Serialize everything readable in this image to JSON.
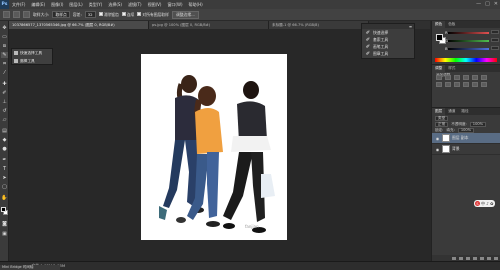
{
  "app": {
    "logo": "Ps"
  },
  "menu": [
    "文件(F)",
    "编辑(E)",
    "图像(I)",
    "图层(L)",
    "类型(Y)",
    "选择(S)",
    "滤镜(T)",
    "视图(V)",
    "窗口(W)",
    "帮助(H)"
  ],
  "window_controls": [
    "—",
    "□",
    "✕"
  ],
  "options_bar": {
    "sample_size_label": "取样大小:",
    "sample_size_value": "取样点",
    "tolerance_label": "容差:",
    "tolerance_value": "32",
    "antialias_label": "消除锯齿",
    "contiguous_label": "连续",
    "all_layers_label": "对所有图层取样",
    "refine_button": "调整边缘..."
  },
  "tabs": [
    {
      "label": "1037866577_1370565346.jpg @ 66.7% (图层 0, RGB/8#)",
      "active": true
    },
    {
      "label": "ps.jpg @ 100% (图层 0, RGB/8#)",
      "active": false
    },
    {
      "label": "未标题-1 @ 66.7% (RGB/8)",
      "active": false
    }
  ],
  "history_flyout": {
    "items": [
      "快速选择工具",
      "魔棒工具"
    ]
  },
  "actions_panel": {
    "items": [
      "快速选择",
      "套索工具",
      "画笔工具",
      "图章工具"
    ]
  },
  "color_panel": {
    "tabs": [
      "颜色",
      "色板"
    ],
    "channels": [
      {
        "label": "R",
        "color": "#e05050"
      },
      {
        "label": "G",
        "color": "#50c050"
      },
      {
        "label": "B",
        "color": "#5070e0"
      }
    ]
  },
  "adjust_panel": {
    "tabs": [
      "调整",
      "样式"
    ],
    "title": "添加调整"
  },
  "layers_panel": {
    "tabs": [
      "图层",
      "通道",
      "路径"
    ],
    "kind": "类型",
    "blend": "正常",
    "opacity_label": "不透明度:",
    "opacity_value": "100%",
    "lock_label": "锁定:",
    "fill_label": "填充:",
    "fill_value": "100%",
    "layers": [
      {
        "name": "图层 副本",
        "selected": true
      },
      {
        "name": "背景",
        "selected": false
      }
    ]
  },
  "badge": {
    "icon": "S",
    "text": "中 ♪ ✿"
  },
  "status": {
    "zoom": "66.67%",
    "doc": "文档:1.03M/1.03M"
  },
  "minibridge": {
    "label": "Mini Bridge   时间轴"
  },
  "canvas": {
    "watermark": "fanjian"
  }
}
